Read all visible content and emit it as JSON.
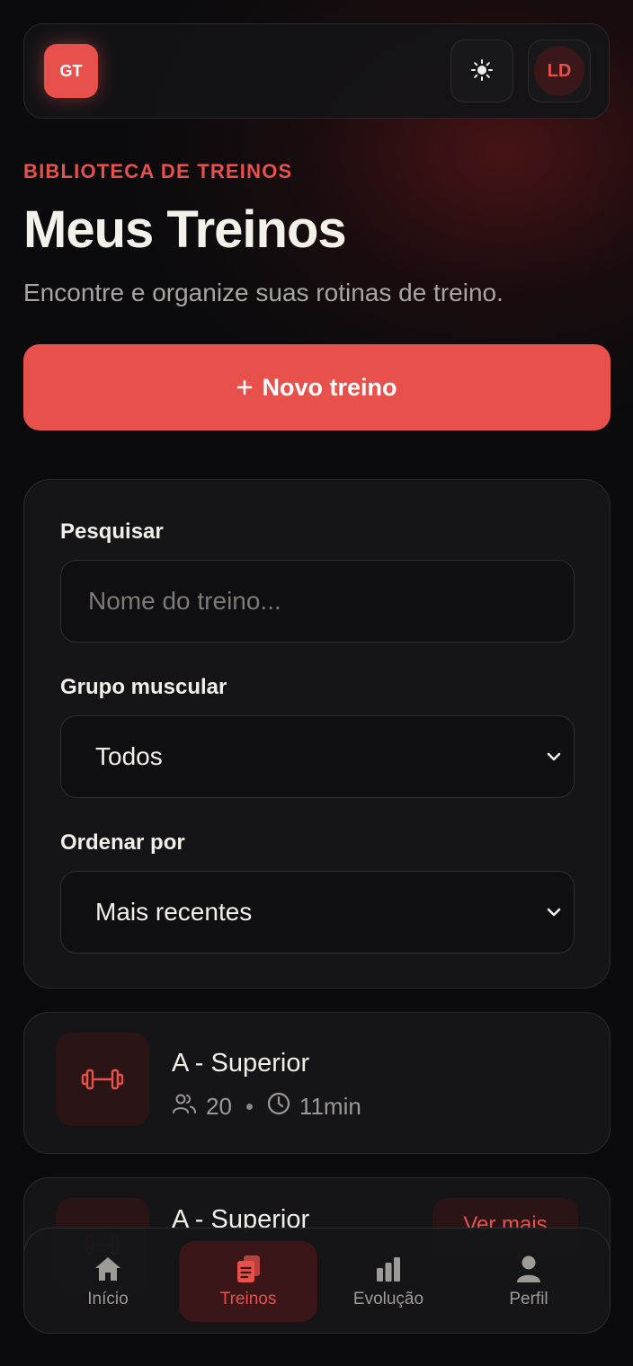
{
  "header": {
    "logo_text": "GT",
    "theme_icon": "sun-icon",
    "avatar_initials": "LD"
  },
  "hero": {
    "eyebrow": "BIBLIOTECA DE TREINOS",
    "title": "Meus Treinos",
    "subtitle": "Encontre e organize suas rotinas de treino.",
    "new_button_label": "Novo treino",
    "new_button_icon": "plus-icon"
  },
  "filters": {
    "search_label": "Pesquisar",
    "search_placeholder": "Nome do treino...",
    "muscle_label": "Grupo muscular",
    "muscle_value": "Todos",
    "sort_label": "Ordenar por",
    "sort_value": "Mais recentes"
  },
  "workouts": [
    {
      "name": "A - Superior",
      "count": "20",
      "duration": "11min",
      "icon": "dumbbell-icon"
    },
    {
      "name": "A - Superior",
      "action_label": "Ver mais",
      "icon": "dumbbell-icon"
    }
  ],
  "nav": [
    {
      "label": "Início",
      "icon": "home-icon",
      "active": false
    },
    {
      "label": "Treinos",
      "icon": "clipboard-icon",
      "active": true
    },
    {
      "label": "Evolução",
      "icon": "bar-chart-icon",
      "active": false
    },
    {
      "label": "Perfil",
      "icon": "user-icon",
      "active": false
    }
  ],
  "colors": {
    "accent": "#e8504c",
    "background": "#0b0b0d",
    "card": "#151518",
    "muted_text": "#a9a6a1"
  }
}
